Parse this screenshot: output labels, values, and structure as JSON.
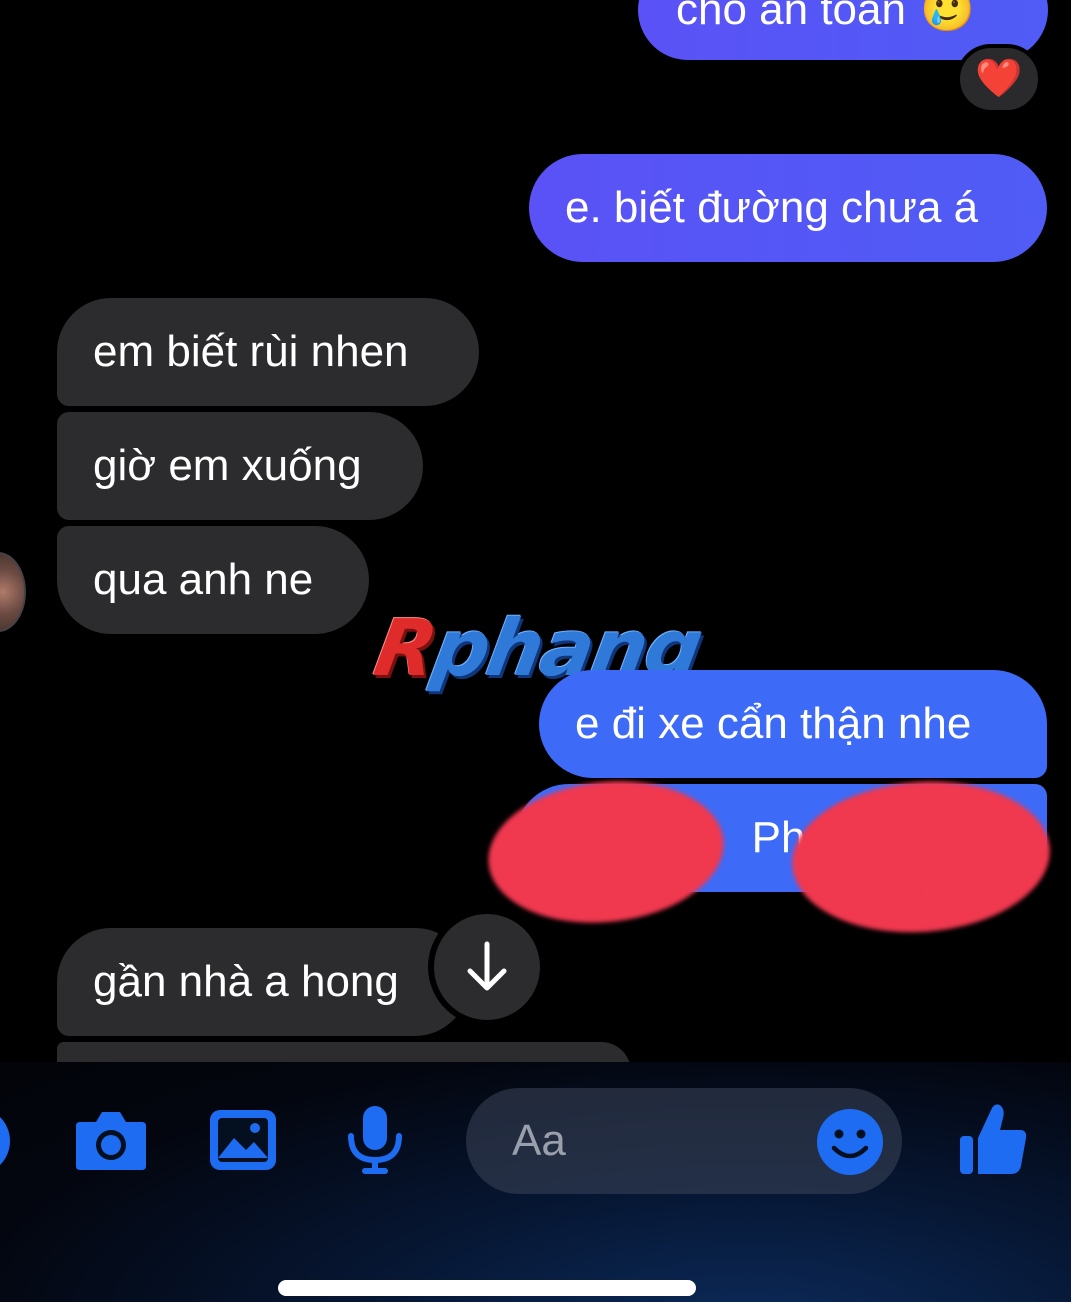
{
  "conversation": {
    "messages": [
      {
        "id": "m1",
        "sender": "me",
        "text": "cho an toàn",
        "emoji": "🥲"
      },
      {
        "id": "m2",
        "sender": "me",
        "text": "e. biết đường chưa á"
      },
      {
        "id": "m3",
        "sender": "them",
        "text": "em biết rùi nhen"
      },
      {
        "id": "m4",
        "sender": "them",
        "text": "giờ em xuống"
      },
      {
        "id": "m5",
        "sender": "them",
        "text": "qua anh ne"
      },
      {
        "id": "m6",
        "sender": "me",
        "text": "e đi xe cẩn thận nhe"
      },
      {
        "id": "m7",
        "sender": "me",
        "text": "Phan",
        "redacted": true
      },
      {
        "id": "m8",
        "sender": "them",
        "text": "gần nhà a hong"
      }
    ],
    "reaction": {
      "emoji": "❤️"
    }
  },
  "watermark": {
    "prefix": "R",
    "rest": "phang"
  },
  "composer": {
    "placeholder": "Aa",
    "icons": [
      "plus-icon",
      "camera-icon",
      "image-icon",
      "microphone-icon",
      "emoji-icon",
      "thumbs-up-icon"
    ]
  },
  "colors": {
    "outgoing_bubble": "#5a52f6",
    "outgoing_bubble_blue": "#3d6af7",
    "incoming_bubble": "#2c2c2e",
    "accent": "#1e6cf2",
    "background": "#000000"
  }
}
